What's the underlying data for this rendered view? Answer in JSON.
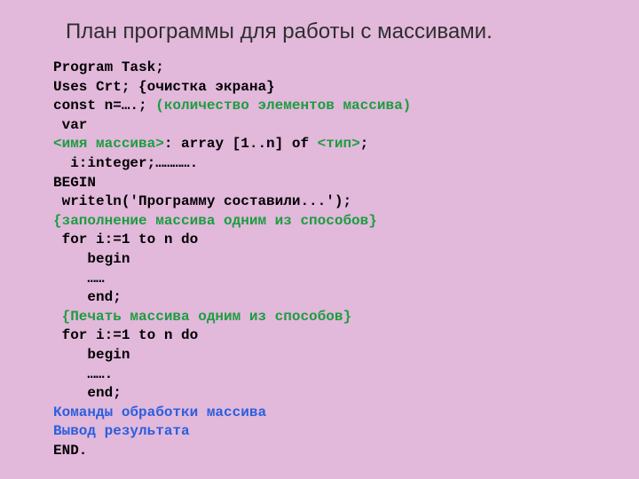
{
  "title": "План программы для работы с массивами.",
  "code": {
    "l1": "Program Task;",
    "l2": "Uses Crt; {очистка экрана}",
    "l3a": "const n=….; ",
    "l3b": "(количество элементов массива)",
    "l4": " var",
    "l5a": "<имя массива>",
    "l5b": ": array [1..n] of ",
    "l5c": "<тип>",
    "l5d": ";",
    "l6": "  i:integer;………….",
    "l7": "BEGIN",
    "l8": " writeln('Программу составили...');",
    "l9": "{заполнение массива одним из способов}",
    "l10": " for i:=1 to n do",
    "l11": "    begin",
    "l12": "    ……",
    "l13": "    end;",
    "l14": " {Печать массива одним из способов}",
    "l15": " for i:=1 to n do",
    "l16": "    begin",
    "l17": "    …….",
    "l18": "    end;",
    "l19": "Команды обработки массива",
    "l20": "Вывод результата",
    "l21": "END."
  }
}
